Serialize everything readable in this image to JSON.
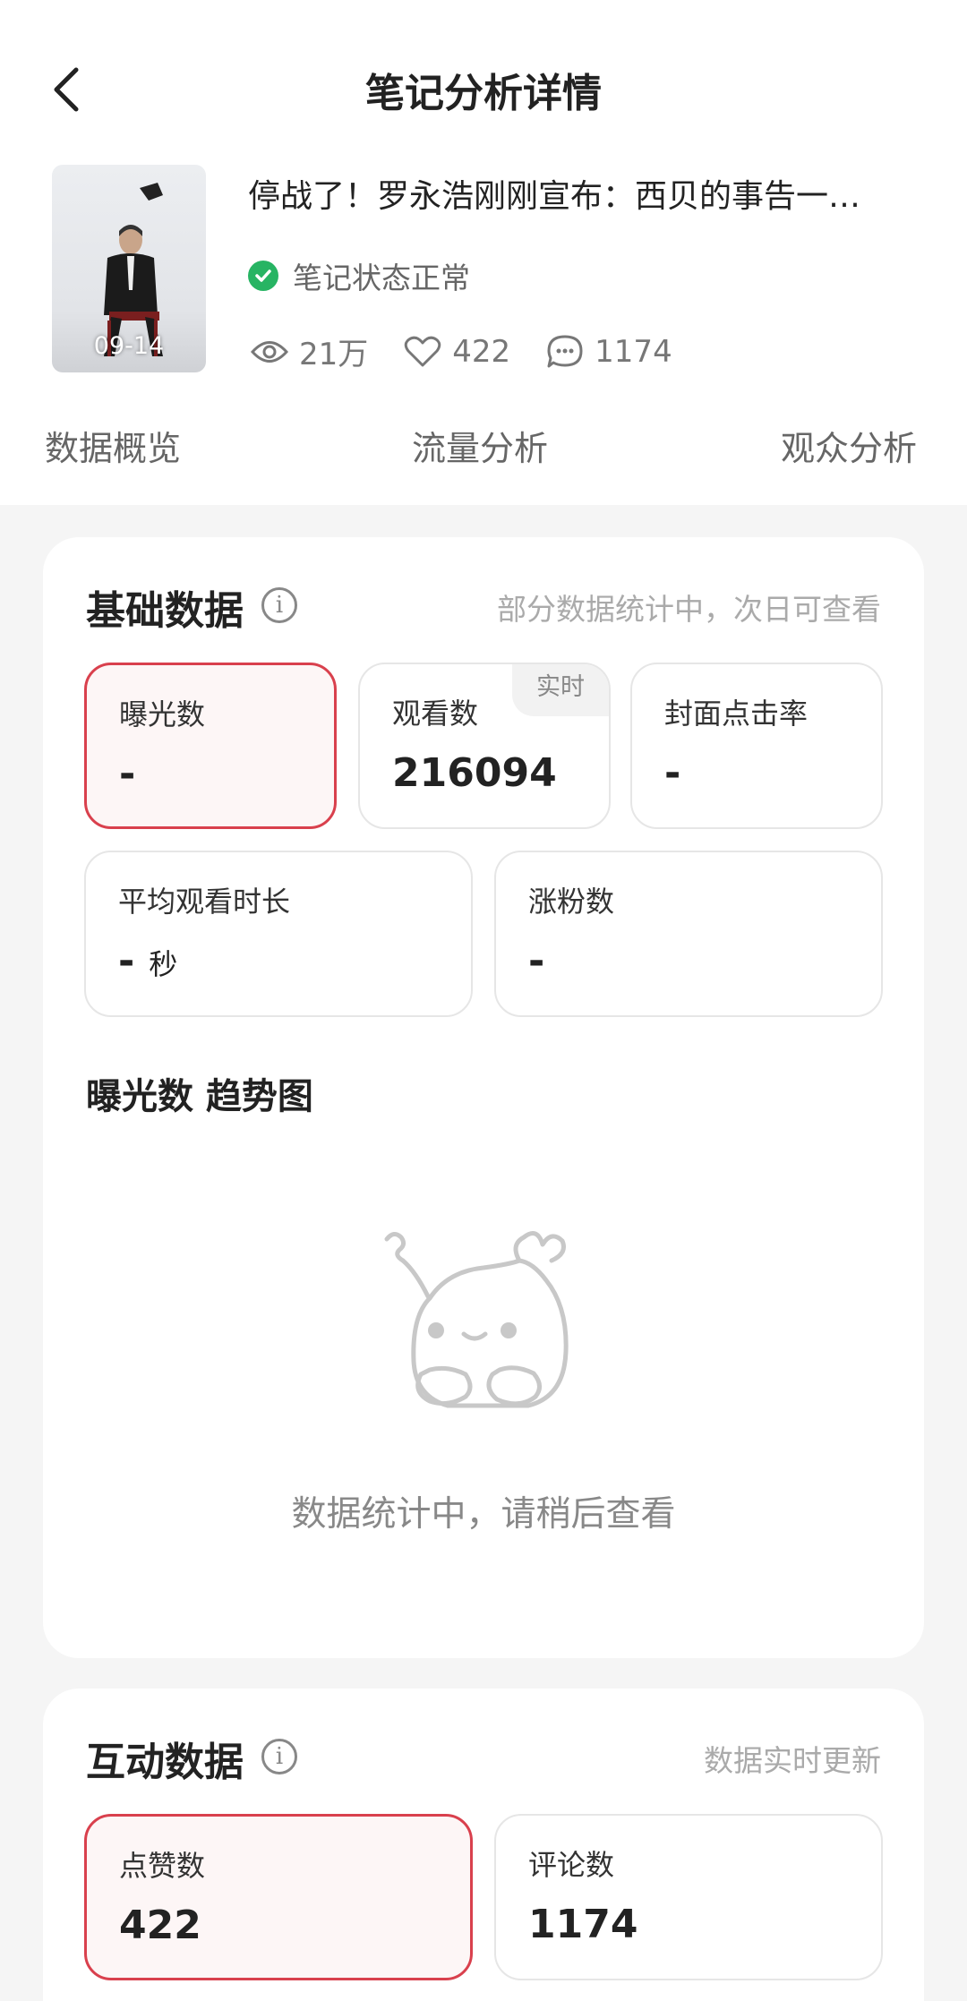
{
  "header": {
    "title": "笔记分析详情"
  },
  "note": {
    "title": "停战了！罗永浩刚刚宣布：西贝的事告一…",
    "thumb_date": "09-14",
    "status": "笔记状态正常",
    "views": "21万",
    "likes": "422",
    "comments": "1174"
  },
  "tabs": [
    "数据概览",
    "流量分析",
    "观众分析"
  ],
  "basic": {
    "title": "基础数据",
    "note": "部分数据统计中，次日可查看",
    "metrics": [
      {
        "label": "曝光数",
        "value": "-"
      },
      {
        "label": "观看数",
        "value": "216094",
        "badge": "实时"
      },
      {
        "label": "封面点击率",
        "value": "-"
      },
      {
        "label": "平均观看时长",
        "value": "-",
        "unit": "秒"
      },
      {
        "label": "涨粉数",
        "value": "-"
      }
    ],
    "chart_title": "曝光数 趋势图",
    "empty_text": "数据统计中，请稍后查看"
  },
  "interaction": {
    "title": "互动数据",
    "note": "数据实时更新",
    "metrics": [
      {
        "label": "点赞数",
        "value": "422"
      },
      {
        "label": "评论数",
        "value": "1174"
      }
    ]
  },
  "colors": {
    "accent": "#d9404d",
    "status_green": "#27b463"
  }
}
